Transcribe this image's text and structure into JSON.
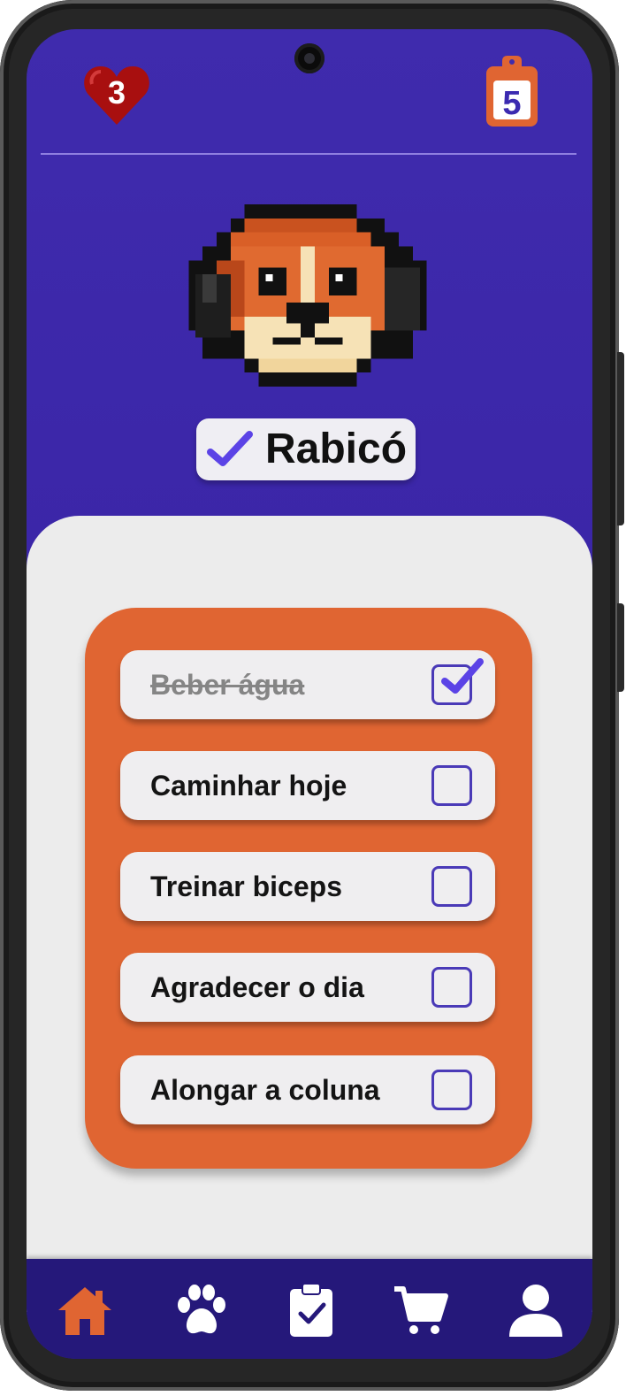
{
  "header": {
    "hearts_count": "3",
    "tasks_count": "5"
  },
  "pet": {
    "name": "Rabicó"
  },
  "tasks": [
    {
      "label": "Beber água",
      "done": true
    },
    {
      "label": "Caminhar hoje",
      "done": false
    },
    {
      "label": "Treinar biceps",
      "done": false
    },
    {
      "label": "Agradecer o dia",
      "done": false
    },
    {
      "label": "Alongar a coluna",
      "done": false
    }
  ],
  "nav": {
    "items": [
      {
        "icon": "home-icon",
        "active": true
      },
      {
        "icon": "paw-icon",
        "active": false
      },
      {
        "icon": "clipboard-check-icon",
        "active": false
      },
      {
        "icon": "cart-icon",
        "active": false
      },
      {
        "icon": "user-icon",
        "active": false
      }
    ]
  },
  "colors": {
    "background": "#3f2bad",
    "accent": "#e06532",
    "check": "#5b43e6",
    "nav": "#25187a",
    "heart": "#a80f0f"
  }
}
